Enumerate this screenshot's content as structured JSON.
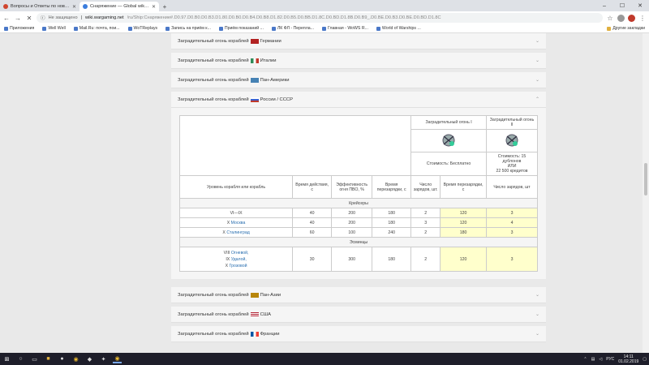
{
  "browser": {
    "tabs": [
      {
        "title": "Вопросы и Ответы по новым ИЗ",
        "active": false
      },
      {
        "title": "Снаряжение — Global wiki. Wa",
        "active": true
      }
    ],
    "new_tab": "+",
    "url_warning": "Не защищено",
    "url_host": "wiki.wargaming.net",
    "url_path": "/ru/Ship:Снаряжение#.D0.97.D0.B0.D0.B3.D1.80.D0.B0.D0.B4.D0.B8.D1.82.D0.B5.D0.BB.D1.8C.D0.BD.D1.8B.D0.B9_.D0.BE.D0.B3.D0.BE.D0.BD.D1.8C",
    "bookmarks": [
      "Приложения",
      "Well Well",
      "Mail.Ru: почта, пои...",
      "WoTReplays",
      "Запись на приём к...",
      "Приём показаний ...",
      "ЛК ФЛ - Перепла...",
      "Главная - WoWS R...",
      "World of Warships ..."
    ],
    "other_bookmarks": "Другие закладки"
  },
  "accordion": {
    "prefix": "Заградительный огонь кораблей",
    "items_before": [
      {
        "nation": "Германии",
        "flag_color": "#b22222"
      },
      {
        "nation": "Италии",
        "flag_color": "#2e8b57"
      },
      {
        "nation": "Пан-Америки",
        "flag_color": "#4682b4"
      }
    ],
    "open": {
      "nation": "России / СССР",
      "flag_color": "#3a5fcd"
    },
    "items_after": [
      {
        "nation": "Пан-Азии",
        "flag_color": "#b8860b"
      },
      {
        "nation": "США",
        "flag_color": "#b22234"
      },
      {
        "nation": "Франции",
        "flag_color": "#0055a4"
      }
    ]
  },
  "table": {
    "mod1_header": "Заградительный огонь I",
    "mod2_header": "Заградительный огонь II",
    "mod1_cost": "Стоимость: Бесплатно",
    "mod2_cost_line1": "Стоимость: 15 дублонов",
    "mod2_cost_line2": "ИЛИ",
    "mod2_cost_line3": "22 500 кредитов",
    "col_ship": "Уровень корабля или корабль",
    "col_duration": "Время действия, с",
    "col_efficiency": "Эффективность огня ПВО, %",
    "col_reload": "Время перезарядки, с",
    "col_charges": "Число зарядов, шт.",
    "col_reload2": "Время перезарядки, с",
    "col_charges2": "Число зарядов, шт",
    "section_cruisers": "Крейсеры",
    "section_destroyers": "Эсминцы",
    "rows_cruisers": [
      {
        "ship": "VI—IX",
        "tier": "",
        "link": "",
        "duration": "40",
        "efficiency": "200",
        "reload": "180",
        "charges": "2",
        "reload2": "120",
        "charges2": "3"
      },
      {
        "ship": "",
        "tier": "X",
        "link": "Москва",
        "duration": "40",
        "efficiency": "200",
        "reload": "180",
        "charges": "3",
        "reload2": "120",
        "charges2": "4"
      },
      {
        "ship": "",
        "tier": "X",
        "link": "Сталинград",
        "duration": "60",
        "efficiency": "100",
        "reload": "240",
        "charges": "2",
        "reload2": "180",
        "charges2": "3"
      }
    ],
    "destroyers": {
      "line1_tier": "VIII",
      "line1_link": "Огневой,",
      "line2_tier": "IX",
      "line2_link": "Удалой,",
      "line3_tier": "X",
      "line3_link": "Грозовой",
      "duration": "30",
      "efficiency": "300",
      "reload": "180",
      "charges": "2",
      "reload2": "120",
      "charges2": "3"
    }
  },
  "taskbar": {
    "lang": "РУС",
    "time": "14:11",
    "date": "01.02.2019"
  }
}
